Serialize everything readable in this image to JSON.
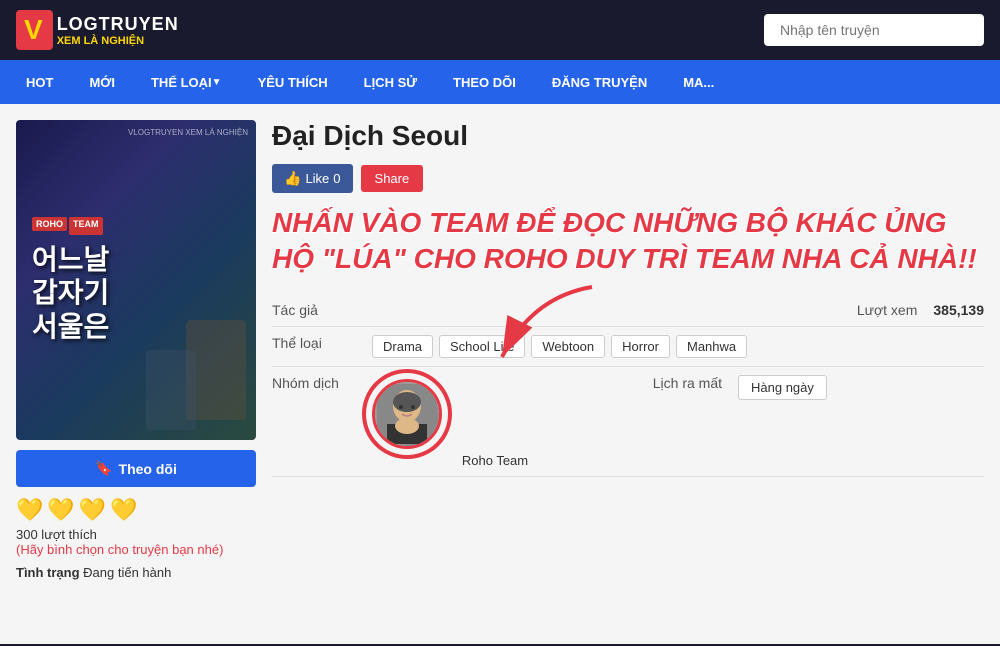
{
  "header": {
    "logo": {
      "v": "V",
      "title": "LOGTRUYEN",
      "subtitle": "XEM LÀ NGHIỆN"
    },
    "search_placeholder": "Nhập tên truyện"
  },
  "nav": {
    "items": [
      {
        "label": "HOT",
        "has_arrow": false
      },
      {
        "label": "MỚI",
        "has_arrow": false
      },
      {
        "label": "THỂ LOẠI",
        "has_arrow": true
      },
      {
        "label": "YÊU THÍCH",
        "has_arrow": false
      },
      {
        "label": "LỊCH SỬ",
        "has_arrow": false
      },
      {
        "label": "THEO DÕI",
        "has_arrow": false
      },
      {
        "label": "ĐĂNG TRUYỆN",
        "has_arrow": false
      },
      {
        "label": "MA...",
        "has_arrow": false
      }
    ]
  },
  "manga": {
    "title": "Đại Dịch Seoul",
    "cover": {
      "badge_roho": "ROHO",
      "badge_team": "TEAM",
      "korean_text": "어느날\n갑자기\n서울은",
      "watermark": "VLOGTRUYEN\nXEM LÀ NGHIỆN"
    },
    "promo_text": "NHẤN VÀO TEAM ĐỂ ĐỌC NHỮNG BỘ KHÁC ỦNG HỘ \"LÚA\" CHO ROHO DUY TRÌ TEAM NHA CẢ NHÀ!!",
    "like_label": "Like",
    "like_count": "0",
    "share_label": "Share",
    "tac_gia_label": "Tác giả",
    "tac_gia_value": "",
    "luot_xem_label": "Lượt xem",
    "luot_xem_value": "385,139",
    "the_loai_label": "Thể loại",
    "genres": [
      "Drama",
      "School Life",
      "Webtoon",
      "Horror",
      "Manhwa"
    ],
    "nhom_dich_label": "Nhóm dịch",
    "team_name": "Roho Team",
    "lich_ra_mat_label": "Lịch ra mất",
    "lich_ra_mat_value": "Hàng ngày",
    "follow_label": "Theo dõi",
    "likes_count": "300 lượt thích",
    "likes_note": "(Hãy bình chọn cho truyện bạn nhé)",
    "tinh_trang_label": "Tình trạng",
    "tinh_trang_value": "Đang tiến hành"
  },
  "icons": {
    "bookmark": "🔖",
    "heart": "💛",
    "thumbup": "👍"
  }
}
